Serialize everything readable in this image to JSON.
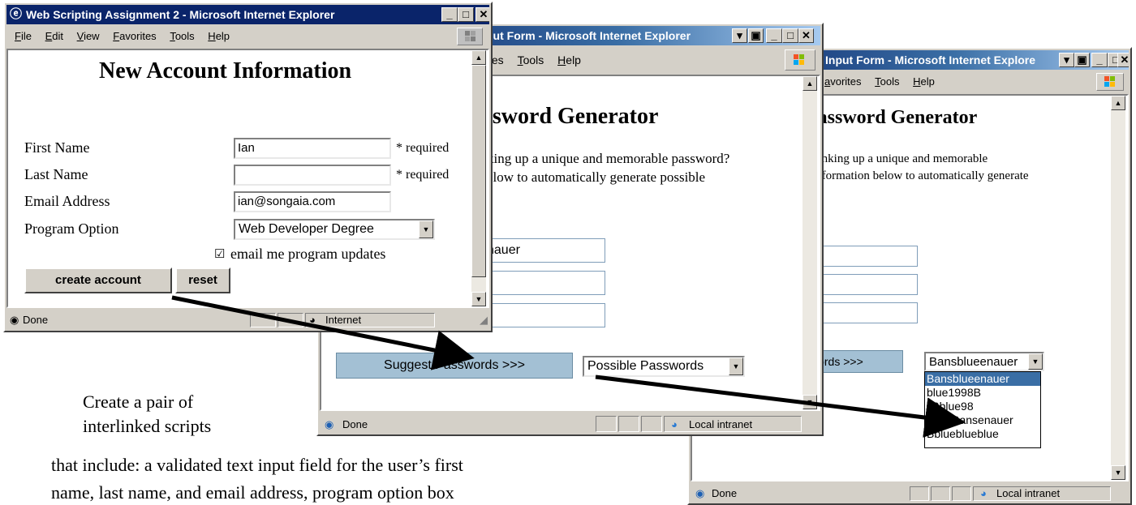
{
  "window_right": {
    "title": "Input Form - Microsoft Internet Explore",
    "menu": [
      "avorites",
      "Tools",
      "Help"
    ],
    "heading": "Password Generator",
    "text_line1": "hinking up a unique and memorable",
    "text_line2": "information below to automatically generate",
    "fields": [
      "",
      "",
      ""
    ],
    "suggest_button_label": "words >>>",
    "select_value": "Bansblueenauer",
    "select_options": [
      "Bansblueenauer",
      "blue1998B",
      "19blue98",
      "1991Bansenauer",
      "Bblueblueblue"
    ],
    "status_text": "Done",
    "zone_text": "Local intranet"
  },
  "window_middle": {
    "title": "put Form - Microsoft Internet Explorer",
    "menu": [
      "tes",
      "Tools",
      "Help"
    ],
    "heading": "ssword Generator",
    "text_line1": "king up a unique and memorable password?",
    "text_line2": "elow to automatically generate possible",
    "fields": [
      "nauer",
      "",
      ""
    ],
    "suggest_button_label": "Suggest Passwords >>>",
    "select_value": "Possible Passwords",
    "status_text": "Done",
    "zone_text": "Local intranet"
  },
  "window_left": {
    "title": "Web Scripting Assignment 2 - Microsoft Internet Explorer",
    "menu": [
      "File",
      "Edit",
      "View",
      "Favorites",
      "Tools",
      "Help"
    ],
    "heading": "New Account Information",
    "rows": [
      {
        "label": "First Name",
        "value": "Ian",
        "note": "* required"
      },
      {
        "label": "Last Name",
        "value": "",
        "note": "* required"
      },
      {
        "label": "Email Address",
        "value": "ian@songaia.com",
        "note": ""
      }
    ],
    "program_label": "Program Option",
    "program_value": "Web Developer Degree",
    "checkbox_label": "email me program updates",
    "checkbox_mark": "☑",
    "create_button": "create account",
    "reset_button": "reset",
    "status_text": "Done",
    "zone_text": "Internet"
  },
  "caption": {
    "line1": "Create a pair of",
    "line2": "interlinked scripts",
    "line3": "that include: a validated text input field for the user’s first",
    "line4": "name, last name, and email address, program option box"
  },
  "colors": {
    "title_active": "#0a246a",
    "xp_button": "#a3c0d4",
    "selection": "#3a6ea5"
  }
}
